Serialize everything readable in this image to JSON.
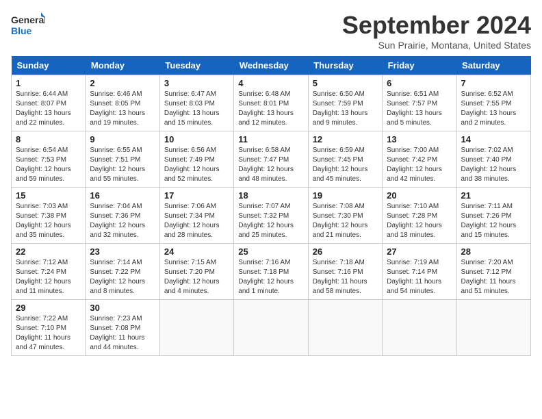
{
  "logo": {
    "line1": "General",
    "line2": "Blue"
  },
  "title": "September 2024",
  "subtitle": "Sun Prairie, Montana, United States",
  "weekdays": [
    "Sunday",
    "Monday",
    "Tuesday",
    "Wednesday",
    "Thursday",
    "Friday",
    "Saturday"
  ],
  "weeks": [
    [
      {
        "day": "1",
        "info": "Sunrise: 6:44 AM\nSunset: 8:07 PM\nDaylight: 13 hours\nand 22 minutes."
      },
      {
        "day": "2",
        "info": "Sunrise: 6:46 AM\nSunset: 8:05 PM\nDaylight: 13 hours\nand 19 minutes."
      },
      {
        "day": "3",
        "info": "Sunrise: 6:47 AM\nSunset: 8:03 PM\nDaylight: 13 hours\nand 15 minutes."
      },
      {
        "day": "4",
        "info": "Sunrise: 6:48 AM\nSunset: 8:01 PM\nDaylight: 13 hours\nand 12 minutes."
      },
      {
        "day": "5",
        "info": "Sunrise: 6:50 AM\nSunset: 7:59 PM\nDaylight: 13 hours\nand 9 minutes."
      },
      {
        "day": "6",
        "info": "Sunrise: 6:51 AM\nSunset: 7:57 PM\nDaylight: 13 hours\nand 5 minutes."
      },
      {
        "day": "7",
        "info": "Sunrise: 6:52 AM\nSunset: 7:55 PM\nDaylight: 13 hours\nand 2 minutes."
      }
    ],
    [
      {
        "day": "8",
        "info": "Sunrise: 6:54 AM\nSunset: 7:53 PM\nDaylight: 12 hours\nand 59 minutes."
      },
      {
        "day": "9",
        "info": "Sunrise: 6:55 AM\nSunset: 7:51 PM\nDaylight: 12 hours\nand 55 minutes."
      },
      {
        "day": "10",
        "info": "Sunrise: 6:56 AM\nSunset: 7:49 PM\nDaylight: 12 hours\nand 52 minutes."
      },
      {
        "day": "11",
        "info": "Sunrise: 6:58 AM\nSunset: 7:47 PM\nDaylight: 12 hours\nand 48 minutes."
      },
      {
        "day": "12",
        "info": "Sunrise: 6:59 AM\nSunset: 7:45 PM\nDaylight: 12 hours\nand 45 minutes."
      },
      {
        "day": "13",
        "info": "Sunrise: 7:00 AM\nSunset: 7:42 PM\nDaylight: 12 hours\nand 42 minutes."
      },
      {
        "day": "14",
        "info": "Sunrise: 7:02 AM\nSunset: 7:40 PM\nDaylight: 12 hours\nand 38 minutes."
      }
    ],
    [
      {
        "day": "15",
        "info": "Sunrise: 7:03 AM\nSunset: 7:38 PM\nDaylight: 12 hours\nand 35 minutes."
      },
      {
        "day": "16",
        "info": "Sunrise: 7:04 AM\nSunset: 7:36 PM\nDaylight: 12 hours\nand 32 minutes."
      },
      {
        "day": "17",
        "info": "Sunrise: 7:06 AM\nSunset: 7:34 PM\nDaylight: 12 hours\nand 28 minutes."
      },
      {
        "day": "18",
        "info": "Sunrise: 7:07 AM\nSunset: 7:32 PM\nDaylight: 12 hours\nand 25 minutes."
      },
      {
        "day": "19",
        "info": "Sunrise: 7:08 AM\nSunset: 7:30 PM\nDaylight: 12 hours\nand 21 minutes."
      },
      {
        "day": "20",
        "info": "Sunrise: 7:10 AM\nSunset: 7:28 PM\nDaylight: 12 hours\nand 18 minutes."
      },
      {
        "day": "21",
        "info": "Sunrise: 7:11 AM\nSunset: 7:26 PM\nDaylight: 12 hours\nand 15 minutes."
      }
    ],
    [
      {
        "day": "22",
        "info": "Sunrise: 7:12 AM\nSunset: 7:24 PM\nDaylight: 12 hours\nand 11 minutes."
      },
      {
        "day": "23",
        "info": "Sunrise: 7:14 AM\nSunset: 7:22 PM\nDaylight: 12 hours\nand 8 minutes."
      },
      {
        "day": "24",
        "info": "Sunrise: 7:15 AM\nSunset: 7:20 PM\nDaylight: 12 hours\nand 4 minutes."
      },
      {
        "day": "25",
        "info": "Sunrise: 7:16 AM\nSunset: 7:18 PM\nDaylight: 12 hours\nand 1 minute."
      },
      {
        "day": "26",
        "info": "Sunrise: 7:18 AM\nSunset: 7:16 PM\nDaylight: 11 hours\nand 58 minutes."
      },
      {
        "day": "27",
        "info": "Sunrise: 7:19 AM\nSunset: 7:14 PM\nDaylight: 11 hours\nand 54 minutes."
      },
      {
        "day": "28",
        "info": "Sunrise: 7:20 AM\nSunset: 7:12 PM\nDaylight: 11 hours\nand 51 minutes."
      }
    ],
    [
      {
        "day": "29",
        "info": "Sunrise: 7:22 AM\nSunset: 7:10 PM\nDaylight: 11 hours\nand 47 minutes."
      },
      {
        "day": "30",
        "info": "Sunrise: 7:23 AM\nSunset: 7:08 PM\nDaylight: 11 hours\nand 44 minutes."
      },
      {
        "day": "",
        "info": ""
      },
      {
        "day": "",
        "info": ""
      },
      {
        "day": "",
        "info": ""
      },
      {
        "day": "",
        "info": ""
      },
      {
        "day": "",
        "info": ""
      }
    ]
  ]
}
